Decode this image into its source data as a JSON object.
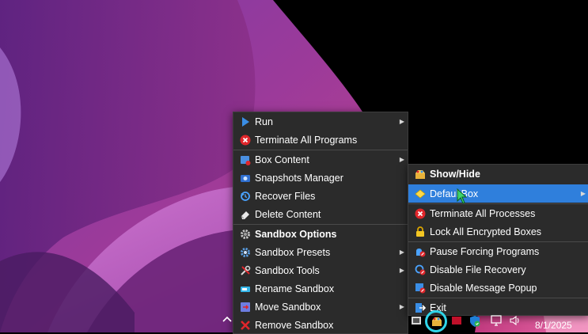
{
  "main_menu": {
    "items": [
      {
        "label": "Run",
        "icon": "play-icon",
        "submenu": true
      },
      {
        "label": "Terminate All Programs",
        "icon": "terminate-icon",
        "submenu": false
      },
      {
        "label": "Box Content",
        "icon": "box-content-icon",
        "submenu": true
      },
      {
        "label": "Snapshots Manager",
        "icon": "camera-icon",
        "submenu": false
      },
      {
        "label": "Recover Files",
        "icon": "recover-icon",
        "submenu": false
      },
      {
        "label": "Delete Content",
        "icon": "eraser-icon",
        "submenu": false
      },
      {
        "label": "Sandbox Options",
        "icon": "gear-icon",
        "submenu": false
      },
      {
        "label": "Sandbox Presets",
        "icon": "presets-icon",
        "submenu": true
      },
      {
        "label": "Sandbox Tools",
        "icon": "tools-icon",
        "submenu": true
      },
      {
        "label": "Rename Sandbox",
        "icon": "rename-icon",
        "submenu": false
      },
      {
        "label": "Move Sandbox",
        "icon": "move-icon",
        "submenu": true
      },
      {
        "label": "Remove Sandbox",
        "icon": "remove-icon",
        "submenu": false
      }
    ]
  },
  "tray_menu": {
    "items": [
      {
        "label": "Show/Hide",
        "icon": "sandbox-icon",
        "submenu": false
      },
      {
        "label": "DefaultBox",
        "icon": "box-icon",
        "submenu": true,
        "selected": true
      },
      {
        "label": "Terminate All Processes",
        "icon": "terminate-icon",
        "submenu": false
      },
      {
        "label": "Lock All Encrypted Boxes",
        "icon": "lock-icon",
        "submenu": false
      },
      {
        "label": "Pause Forcing Programs",
        "icon": "pause-forcing-icon",
        "submenu": false
      },
      {
        "label": "Disable File Recovery",
        "icon": "disable-recovery-icon",
        "submenu": false
      },
      {
        "label": "Disable Message Popup",
        "icon": "disable-popup-icon",
        "submenu": false
      },
      {
        "label": "Exit",
        "icon": "exit-icon",
        "submenu": false
      }
    ]
  },
  "taskbar": {
    "date": "8/1/2025"
  },
  "colors": {
    "menu_bg": "#2b2b2b",
    "selected": "#2f7fdc",
    "highlight_ring": "#2fd4e8",
    "accent_red": "#e0262b"
  }
}
